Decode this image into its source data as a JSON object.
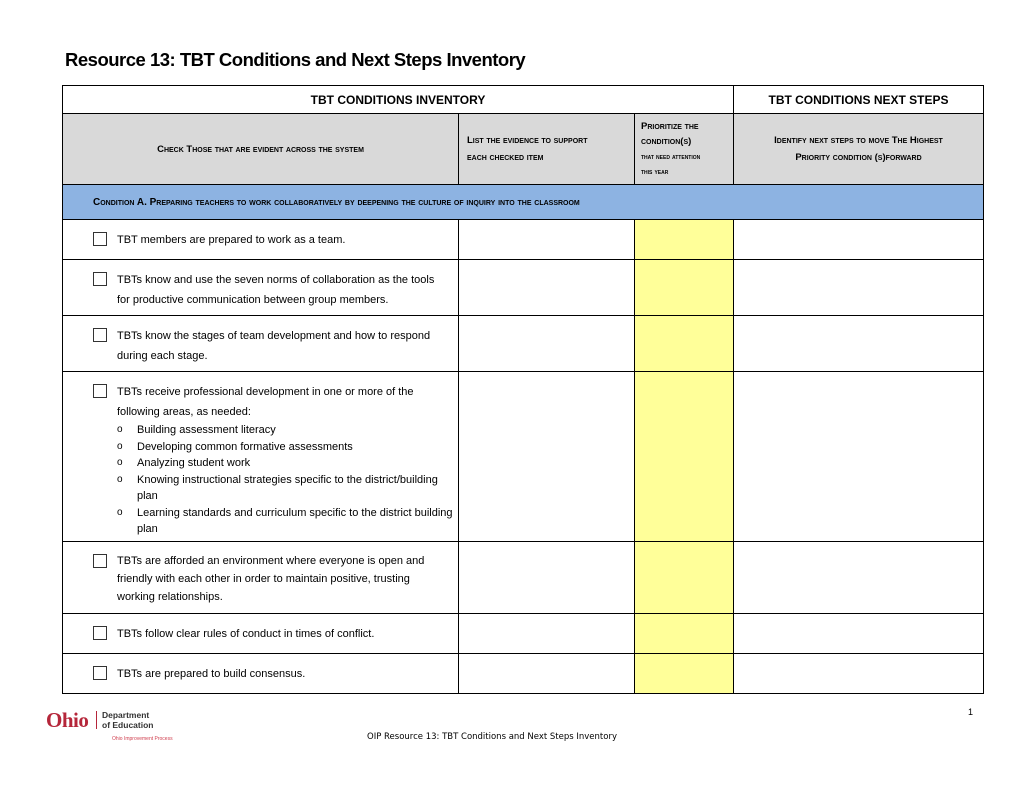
{
  "document": {
    "title": "Resource 13: TBT Conditions and Next Steps Inventory",
    "page_number": "1",
    "footer_text": "OIP Resource 13: TBT Conditions and Next Steps Inventory"
  },
  "logo": {
    "ohio": "Ohio",
    "dept_line1": "Department",
    "dept_line2": "of Education",
    "tagline": "Ohio Improvement Process"
  },
  "table": {
    "header_inventory": "TBT CONDITIONS INVENTORY",
    "header_next_steps": "TBT CONDITIONS NEXT STEPS",
    "col_check": "Check Those that are evident across the system",
    "col_evidence_1": "List the evidence to support",
    "col_evidence_2": "each checked item",
    "col_prioritize_1": "Prioritize the",
    "col_prioritize_2": "condition(s)",
    "col_prioritize_3": "that need attention",
    "col_prioritize_4": "this year",
    "col_next_1": "Identify next steps to move The Highest",
    "col_next_2": "Priority condition (s)forward",
    "condition_a": "Condition A. Preparing teachers to work collaboratively by deepening the culture of inquiry into the classroom",
    "items": [
      {
        "text": "TBT members are prepared to work as a team.",
        "checked": false
      },
      {
        "text": "TBTs know and use the seven norms of collaboration as the tools for productive communication between group members.",
        "checked": false
      },
      {
        "text": "TBTs know the stages of team development and how to respond during each stage.",
        "checked": false
      },
      {
        "text": "TBTs receive professional development in one or more of the following areas, as needed:",
        "checked": false,
        "subitems": [
          "Building assessment literacy",
          "Developing common formative assessments",
          "Analyzing student work",
          "Knowing instructional strategies specific to the district/building plan",
          "Learning standards and curriculum specific to the district building plan"
        ]
      },
      {
        "text": "TBTs are afforded an environment where everyone is open and friendly with each other in order to maintain positive, trusting working relationships.",
        "checked": false
      },
      {
        "text": "TBTs follow clear rules of conduct in times of conflict.",
        "checked": false
      },
      {
        "text": "TBTs are prepared to build consensus.",
        "checked": false
      }
    ],
    "colors": {
      "header_gray": "#d9d9d9",
      "condition_blue": "#8db3e2",
      "priority_yellow": "#ffff99"
    }
  }
}
